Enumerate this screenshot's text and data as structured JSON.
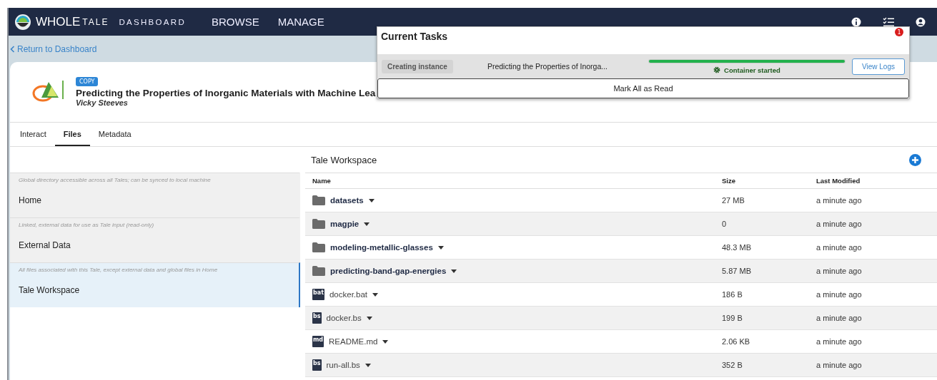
{
  "navbar": {
    "brand_main": "WHOLE",
    "brand_sub": "TALE",
    "links": [
      {
        "label": "DASHBOARD",
        "kind": "small"
      },
      {
        "label": "BROWSE",
        "kind": "large"
      },
      {
        "label": "MANAGE",
        "kind": "large"
      }
    ]
  },
  "back_link": "Return to Dashboard",
  "tale": {
    "badge": "COPY",
    "title": "Predicting the Properties of Inorganic Materials with Machine Lea",
    "author": "Vicky Steeves"
  },
  "tabs": [
    {
      "label": "Interact",
      "selected": false
    },
    {
      "label": "Files",
      "selected": true
    },
    {
      "label": "Metadata",
      "selected": false
    }
  ],
  "sidebar": {
    "items": [
      {
        "description": "Global directory accessible across all Tales; can be synced to local machine",
        "label": "Home",
        "selected": false
      },
      {
        "description": "Linked, external data for use as Tale input (read-only)",
        "label": "External Data",
        "selected": false
      },
      {
        "description": "All files associated with this Tale, except external data and global files in Home",
        "label": "Tale Workspace",
        "selected": true
      }
    ]
  },
  "workspace": {
    "title": "Tale Workspace",
    "columns": [
      "Name",
      "Size",
      "Last Modified"
    ],
    "rows": [
      {
        "kind": "folder",
        "name": "datasets",
        "size": "27 MB",
        "modified": "a minute ago"
      },
      {
        "kind": "folder",
        "name": "magpie",
        "size": "0",
        "modified": "a minute ago"
      },
      {
        "kind": "folder",
        "name": "modeling-metallic-glasses",
        "size": "48.3 MB",
        "modified": "a minute ago"
      },
      {
        "kind": "folder",
        "name": "predicting-band-gap-energies",
        "size": "5.87 MB",
        "modified": "a minute ago"
      },
      {
        "kind": "file",
        "ext": "bat",
        "name": "docker.bat",
        "size": "186 B",
        "modified": "a minute ago"
      },
      {
        "kind": "file",
        "ext": "bs",
        "name": "docker.bs",
        "size": "199 B",
        "modified": "a minute ago"
      },
      {
        "kind": "file",
        "ext": "md",
        "name": "README.md",
        "size": "2.06 KB",
        "modified": "a minute ago"
      },
      {
        "kind": "file",
        "ext": "bs",
        "name": "run-all.bs",
        "size": "352 B",
        "modified": "a minute ago"
      }
    ]
  },
  "tasks_popup": {
    "title": "Current Tasks",
    "badge": "1",
    "tasks": [
      {
        "tag": "Creating instance",
        "name": "Predicting the Properties of Inorga...",
        "level": 1.0,
        "status": "Container started",
        "button": "View Logs"
      }
    ],
    "footer_button": "Mark All as Read"
  }
}
